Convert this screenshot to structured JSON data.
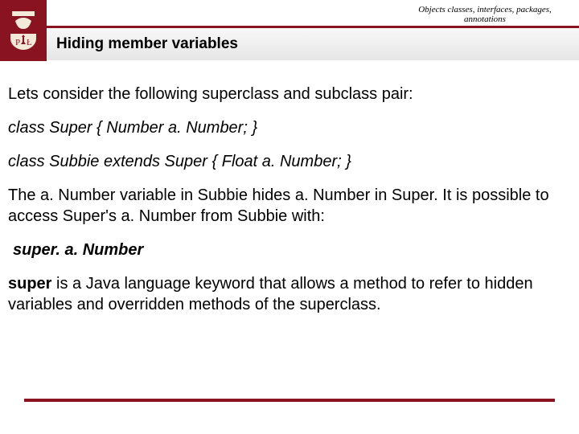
{
  "header": {
    "topic_line1": "Objects classes, interfaces, packages,",
    "topic_line2": "annotations",
    "title": "Hiding member variables"
  },
  "body": {
    "p1": "Lets consider the following superclass and subclass pair:",
    "code1": "class Super { Number a. Number; }",
    "code2": "class Subbie extends Super { Float a. Number; }",
    "p2": "The a. Number variable in Subbie hides a. Number in Super. It is possible to access Super's a. Number from Subbie with:",
    "kw_example": "super. a. Number",
    "p3_kw": "super",
    "p3_rest": " is a Java language keyword that allows a method to refer to hidden variables and overridden methods of the superclass."
  },
  "colors": {
    "brand": "#8a1321"
  }
}
